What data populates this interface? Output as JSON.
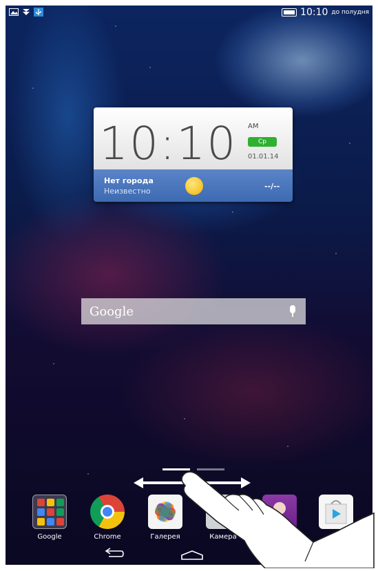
{
  "status_bar": {
    "time": "10:10",
    "period": "до полудня",
    "icons": [
      "picture-icon",
      "notification-icon",
      "usb-icon",
      "battery-icon"
    ]
  },
  "clock_widget": {
    "time": "10:10",
    "ampm": "AM",
    "day": "Ср",
    "date": "01.01.14",
    "weather": {
      "city": "Нет города",
      "condition": "Неизвестно",
      "temperature": "--/--"
    }
  },
  "search": {
    "logo": "Google"
  },
  "dock": [
    {
      "label": "Google"
    },
    {
      "label": "Chrome"
    },
    {
      "label": "Галерея"
    },
    {
      "label": "Камера"
    },
    {
      "label": ""
    },
    {
      "label": ""
    }
  ],
  "colors": {
    "day_badge": "#2fb030",
    "weather_band": "#4b77bf"
  }
}
